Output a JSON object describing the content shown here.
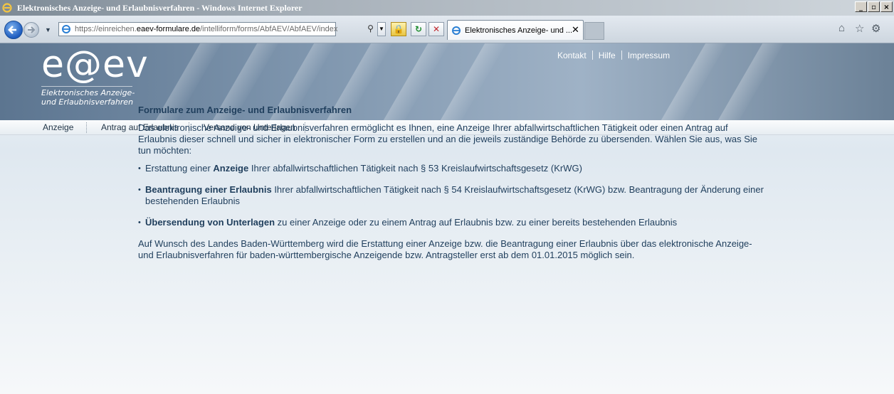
{
  "window": {
    "title": "Elektronisches Anzeige- und Erlaubnisverfahren - Windows Internet Explorer",
    "buttons": {
      "minimize": "_",
      "maximize": "▫",
      "close": "×"
    }
  },
  "browser": {
    "url_prefix": "https://einreichen.",
    "url_domain": "eaev-formulare.de",
    "url_path": "/intelliform/forms/AbfAEV/AbfAEV/index",
    "tab_label": "Elektronisches Anzeige- und ...",
    "tab_close": "✕",
    "icons": [
      "back-arrow-icon",
      "forward-arrow-icon",
      "search-icon",
      "lock-icon",
      "refresh-icon",
      "stop-icon",
      "home-icon",
      "star-icon",
      "gear-icon"
    ]
  },
  "header": {
    "logo": "e@ev",
    "logo_sub1": "Elektronisches Anzeige-",
    "logo_sub2": "und Erlaubnisverfahren",
    "links": {
      "kontakt": "Kontakt",
      "hilfe": "Hilfe",
      "impressum": "Impressum"
    }
  },
  "menu": {
    "items": [
      "Anzeige",
      "Antrag auf Erlaubnis",
      "Versand von Unterlagen"
    ]
  },
  "content": {
    "title": "Formulare zum Anzeige- und Erlaubnisverfahren",
    "intro": "Das elektronische Anzeige- und Erlaubnisverfahren ermöglicht es Ihnen, eine Anzeige Ihrer abfallwirtschaftlichen Tätigkeit oder einen Antrag auf Erlaubnis dieser schnell und sicher in elektronischer Form zu erstellen und an die jeweils zuständige Behörde zu übersenden. Wählen Sie aus, was Sie tun möchten:",
    "options": [
      {
        "pre": "Erstattung einer ",
        "link": "Anzeige",
        "post": " Ihrer abfallwirtschaftlichen Tätigkeit nach § 53 Kreislaufwirtschaftsgesetz (KrWG)"
      },
      {
        "pre": "",
        "link": "Beantragung einer Erlaubnis",
        "post": " Ihrer abfallwirtschaftlichen Tätigkeit nach § 54 Kreislaufwirtschaftsgesetz (KrWG) bzw. Beantragung der Änderung einer bestehenden Erlaubnis"
      },
      {
        "pre": "",
        "link": "Übersendung von Unterlagen",
        "post": " zu einer Anzeige oder zu einem Antrag auf Erlaubnis bzw. zu einer bereits bestehenden Erlaubnis"
      }
    ],
    "note": "Auf Wunsch des Landes Baden-Württemberg wird die Erstattung einer Anzeige bzw. die Beantragung einer Erlaubnis über das elektronische Anzeige- und Erlaubnisverfahren für baden-württembergische Anzeigende bzw. Antragsteller erst ab dem 01.01.2015 möglich sein."
  },
  "colors": {
    "text": "#1f3e5c",
    "header_bg": "#7f96ae"
  }
}
